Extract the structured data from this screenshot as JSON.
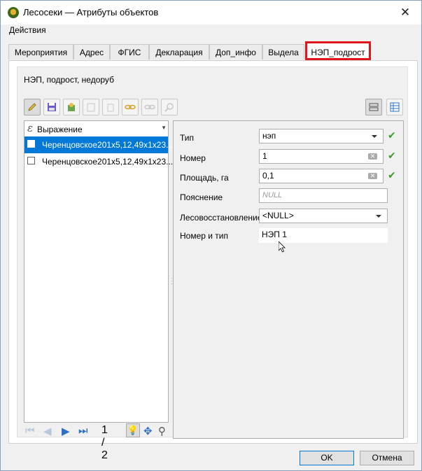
{
  "window": {
    "title": "Лесосеки — Атрибуты объектов",
    "close": "✕"
  },
  "menu": {
    "actions": "Действия"
  },
  "tabs": [
    {
      "label": "Мероприятия"
    },
    {
      "label": "Адрес"
    },
    {
      "label": "ФГИС"
    },
    {
      "label": "Декларация"
    },
    {
      "label": "Доп_инфо"
    },
    {
      "label": "Выдела"
    },
    {
      "label": "НЭП_подрост",
      "active": true
    }
  ],
  "layer": {
    "title": "НЭП, подрост, недоруб"
  },
  "toolbar": {
    "icons": [
      "edit-pencil-icon",
      "save-edits-icon",
      "reload-icon",
      "paste-icon",
      "delete-icon",
      "zoom-to-icon",
      "pan-to-icon",
      "zoom-in-icon",
      "form-view-icon",
      "table-view-icon"
    ]
  },
  "list": {
    "header": "Выражение",
    "header_symbol": "ε",
    "rows": [
      {
        "text": "Черенцовское201х5,12,49х1х23...",
        "selected": true
      },
      {
        "text": "Черенцовское201х5,12,49х1х23...",
        "selected": false
      }
    ]
  },
  "nav": {
    "page": "1 / 2"
  },
  "form": {
    "fields": [
      {
        "label": "Тип",
        "value": "нэп",
        "kind": "combo",
        "valid": true
      },
      {
        "label": "Номер",
        "value": "1",
        "kind": "text",
        "valid": true
      },
      {
        "label": "Площадь, га",
        "value": "0,1",
        "kind": "text",
        "valid": true
      },
      {
        "label": "Пояснение",
        "value": "NULL",
        "kind": "placeholder",
        "valid": false
      },
      {
        "label": "Лесовосстановление",
        "value": "<NULL>",
        "kind": "combo",
        "valid": false
      },
      {
        "label": "Номер и тип",
        "value": "НЭП 1",
        "kind": "readonly",
        "valid": false
      }
    ]
  },
  "buttons": {
    "ok": "OK",
    "cancel": "Отмена"
  },
  "colors": {
    "accent": "#0078d7",
    "tab_highlight": "#e0141b",
    "valid": "#3a9a2a"
  }
}
